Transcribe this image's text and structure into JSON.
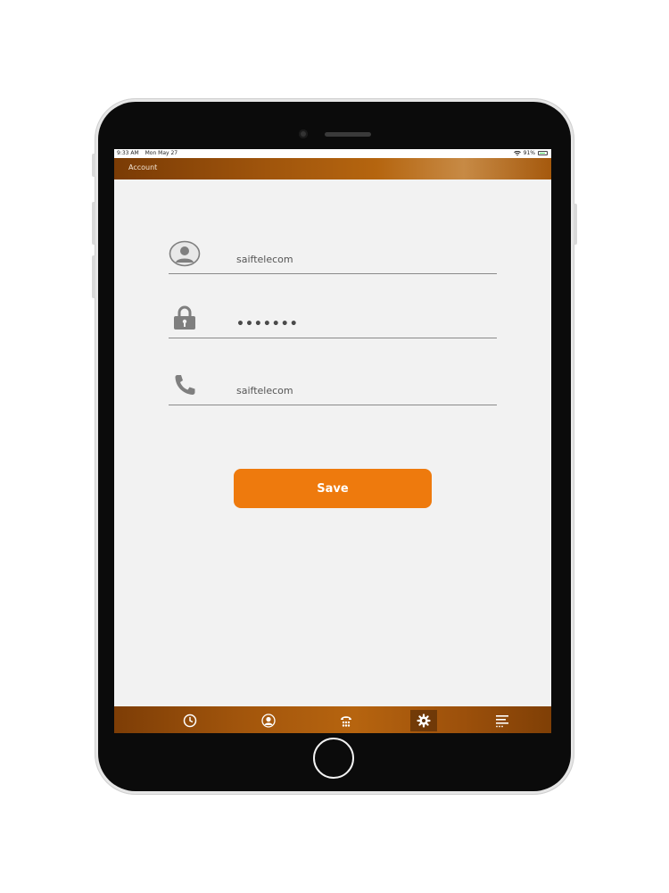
{
  "status_bar": {
    "time": "9:33 AM",
    "date": "Mon May 27",
    "battery": "91%",
    "icons": [
      "wifi-icon",
      "battery-icon"
    ]
  },
  "header": {
    "title": "Account"
  },
  "form": {
    "username": {
      "icon": "user-icon",
      "value": "saiftelecom"
    },
    "password": {
      "icon": "lock-icon",
      "value": "•••••••"
    },
    "phone": {
      "icon": "phone-icon",
      "value": "saiftelecom"
    }
  },
  "save_button": {
    "label": "Save"
  },
  "tab_bar": {
    "tabs": [
      {
        "name": "recents",
        "icon": "clock-icon"
      },
      {
        "name": "contacts",
        "icon": "contact-icon"
      },
      {
        "name": "keypad",
        "icon": "keypad-icon"
      },
      {
        "name": "settings",
        "icon": "gear-icon",
        "active": true
      },
      {
        "name": "more",
        "icon": "menu-icon"
      }
    ]
  },
  "colors": {
    "accent": "#ee7a0d",
    "header_brown": "#a0550c",
    "screen_background": "#f2f2f2"
  }
}
